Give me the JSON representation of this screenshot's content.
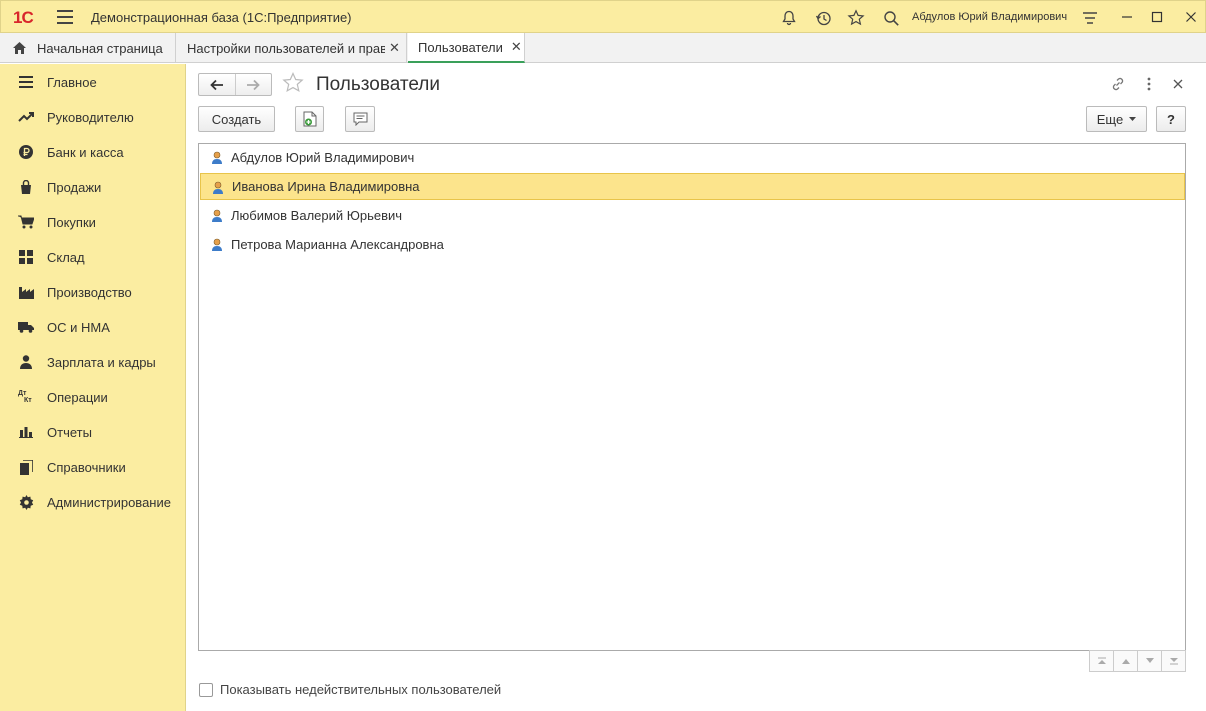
{
  "app": {
    "logo_text": "1С",
    "title": "Демонстрационная база  (1С:Предприятие)",
    "user": "Абдулов Юрий Владимирович",
    "colors": {
      "accent": "#fbeda1",
      "selection": "#fce48c",
      "tab_active_line": "#3aa05a",
      "logo": "#d8262b"
    }
  },
  "tabs": [
    {
      "label": "Начальная страница",
      "icon": "home-icon"
    },
    {
      "label": "Настройки пользователей и прав",
      "close": "✕"
    },
    {
      "label": "Пользователи",
      "close": "✕"
    }
  ],
  "sidebar": {
    "items": [
      {
        "label": "Главное",
        "icon": "menu-lines-icon"
      },
      {
        "label": "Руководителю",
        "icon": "trend-icon"
      },
      {
        "label": "Банк и касса",
        "icon": "ruble-coin-icon"
      },
      {
        "label": "Продажи",
        "icon": "bag-icon"
      },
      {
        "label": "Покупки",
        "icon": "cart-icon"
      },
      {
        "label": "Склад",
        "icon": "warehouse-icon"
      },
      {
        "label": "Производство",
        "icon": "factory-icon"
      },
      {
        "label": "ОС и НМА",
        "icon": "truck-icon"
      },
      {
        "label": "Зарплата и кадры",
        "icon": "person-icon"
      },
      {
        "label": "Операции",
        "icon": "dt-kt-icon"
      },
      {
        "label": "Отчеты",
        "icon": "bar-chart-icon"
      },
      {
        "label": "Справочники",
        "icon": "books-icon"
      },
      {
        "label": "Администрирование",
        "icon": "gear-icon"
      }
    ]
  },
  "main": {
    "title": "Пользователи",
    "create_label": "Создать",
    "more_label": "Еще",
    "help_label": "?",
    "users": [
      "Абдулов Юрий Владимирович",
      "Иванова Ирина Владимировна",
      "Любимов Валерий Юрьевич",
      "Петрова Марианна Александровна"
    ],
    "selected_index": 1,
    "show_inactive_label": "Показывать недействительных пользователей",
    "show_inactive_checked": false
  }
}
